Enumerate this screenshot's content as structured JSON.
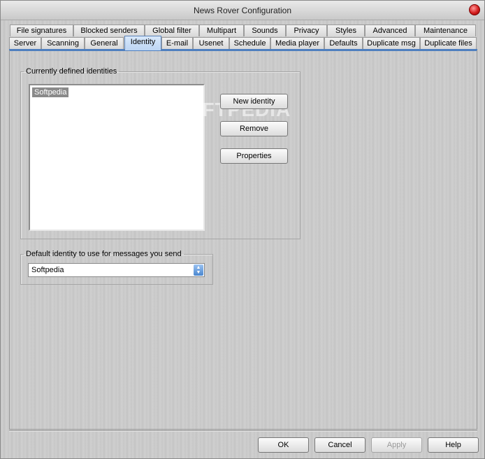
{
  "window": {
    "title": "News Rover Configuration"
  },
  "tabs_row1": [
    "File signatures",
    "Blocked senders",
    "Global filter",
    "Multipart",
    "Sounds",
    "Privacy",
    "Styles",
    "Advanced",
    "Maintenance"
  ],
  "tabs_row2": [
    "Server",
    "Scanning",
    "General",
    "Identity",
    "E-mail",
    "Usenet",
    "Schedule",
    "Media player",
    "Defaults",
    "Duplicate msg",
    "Duplicate files"
  ],
  "active_tab": "Identity",
  "identities": {
    "legend": "Currently defined identities",
    "items": [
      "Softpedia"
    ],
    "selected": "Softpedia",
    "new_label": "New identity",
    "remove_label": "Remove",
    "properties_label": "Properties"
  },
  "default_identity": {
    "legend": "Default identity to use for messages you send",
    "value": "Softpedia"
  },
  "watermark": "SOFTPEDIA",
  "footer": {
    "ok": "OK",
    "cancel": "Cancel",
    "apply": "Apply",
    "help": "Help"
  }
}
